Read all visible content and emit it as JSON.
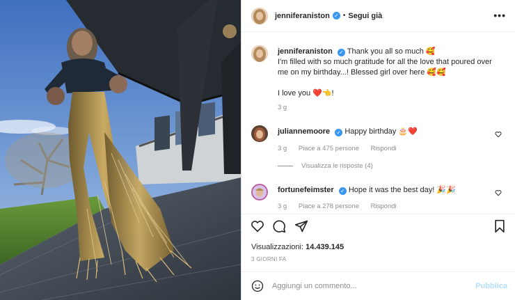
{
  "post": {
    "author": "jenniferaniston",
    "follow_dot": "•",
    "follow_label": "Segui già",
    "more_icon": "more-horizontal-icon"
  },
  "caption": {
    "username": "jenniferaniston",
    "line1": "Thank you all so much 🥰",
    "line2": "I'm filled with so much gratitude for all the love that poured over me on my birthday...! Blessed girl over here 🥰🥰",
    "line3": "I love you ❤️👈!",
    "time": "3 g"
  },
  "comments": [
    {
      "username": "juliannemoore",
      "text": "Happy birthday 🎂❤️",
      "time": "3 g",
      "likes": "Piace a 475 persone",
      "reply": "Rispondi"
    },
    {
      "username": "fortunefeimster",
      "text": "Hope it was the best day! 🎉🎉",
      "time": "3 g",
      "likes": "Piace a 278 persone",
      "reply": "Rispondi"
    }
  ],
  "replies_toggle": "Visualizza le risposte (4)",
  "stats": {
    "views_label": "Visualizzazioni:",
    "views_value": "14.439.145",
    "date": "3 GIORNI FA"
  },
  "composer": {
    "placeholder": "Aggiungi un commento...",
    "publish_label": "Pubblica"
  },
  "colors": {
    "verified": "#3897f0",
    "heart": "#ed4956",
    "publish_disabled": "#b2dffc"
  }
}
